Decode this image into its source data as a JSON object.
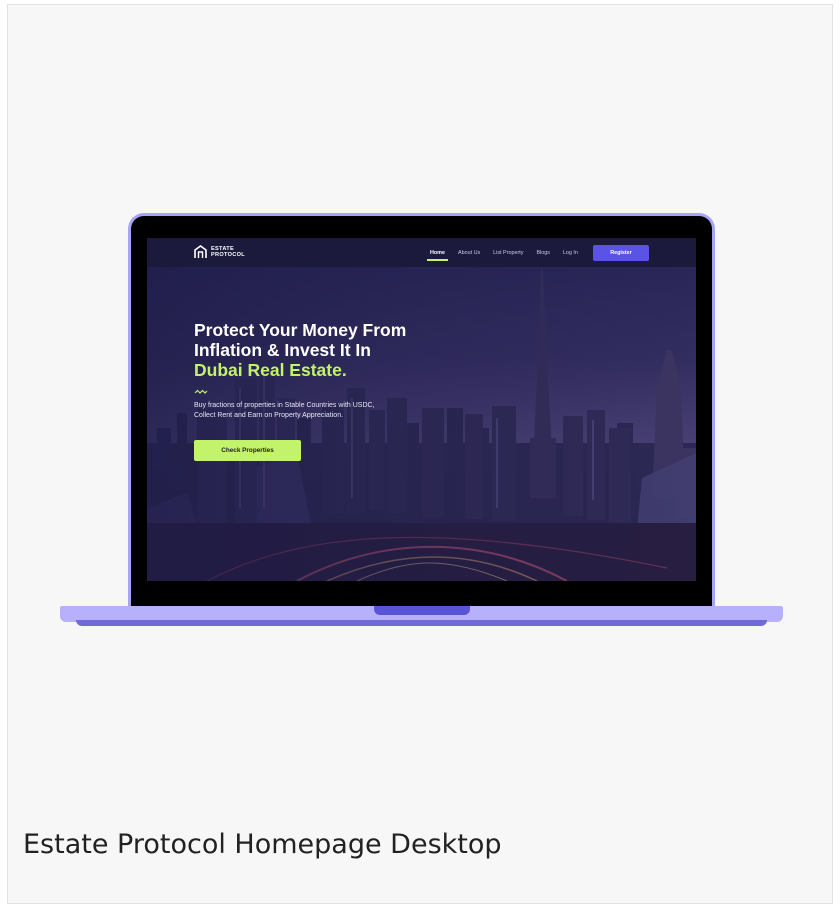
{
  "site": {
    "logo_line1": "ESTATE",
    "logo_line2": "PROTOCOL",
    "nav": {
      "home": "Home",
      "about": "About Us",
      "list_property": "List Property",
      "blogs": "Blogs",
      "login": "Log In",
      "register": "Register"
    },
    "hero": {
      "title_line1": "Protect Your Money From",
      "title_line2": "Inflation & Invest It In",
      "title_accent": "Dubai Real Estate.",
      "subtitle_line1": "Buy fractions of properties in Stable Countries with USDC,",
      "subtitle_line2": "Collect Rent and Earn on Property Appreciation.",
      "cta": "Check Properties"
    }
  },
  "caption": "Estate Protocol Homepage Desktop",
  "colors": {
    "accent_green": "#c3f36a",
    "brand_purple": "#5b53e6",
    "laptop_frame": "#a9a3f7",
    "nav_bg": "#1b1a3d"
  }
}
